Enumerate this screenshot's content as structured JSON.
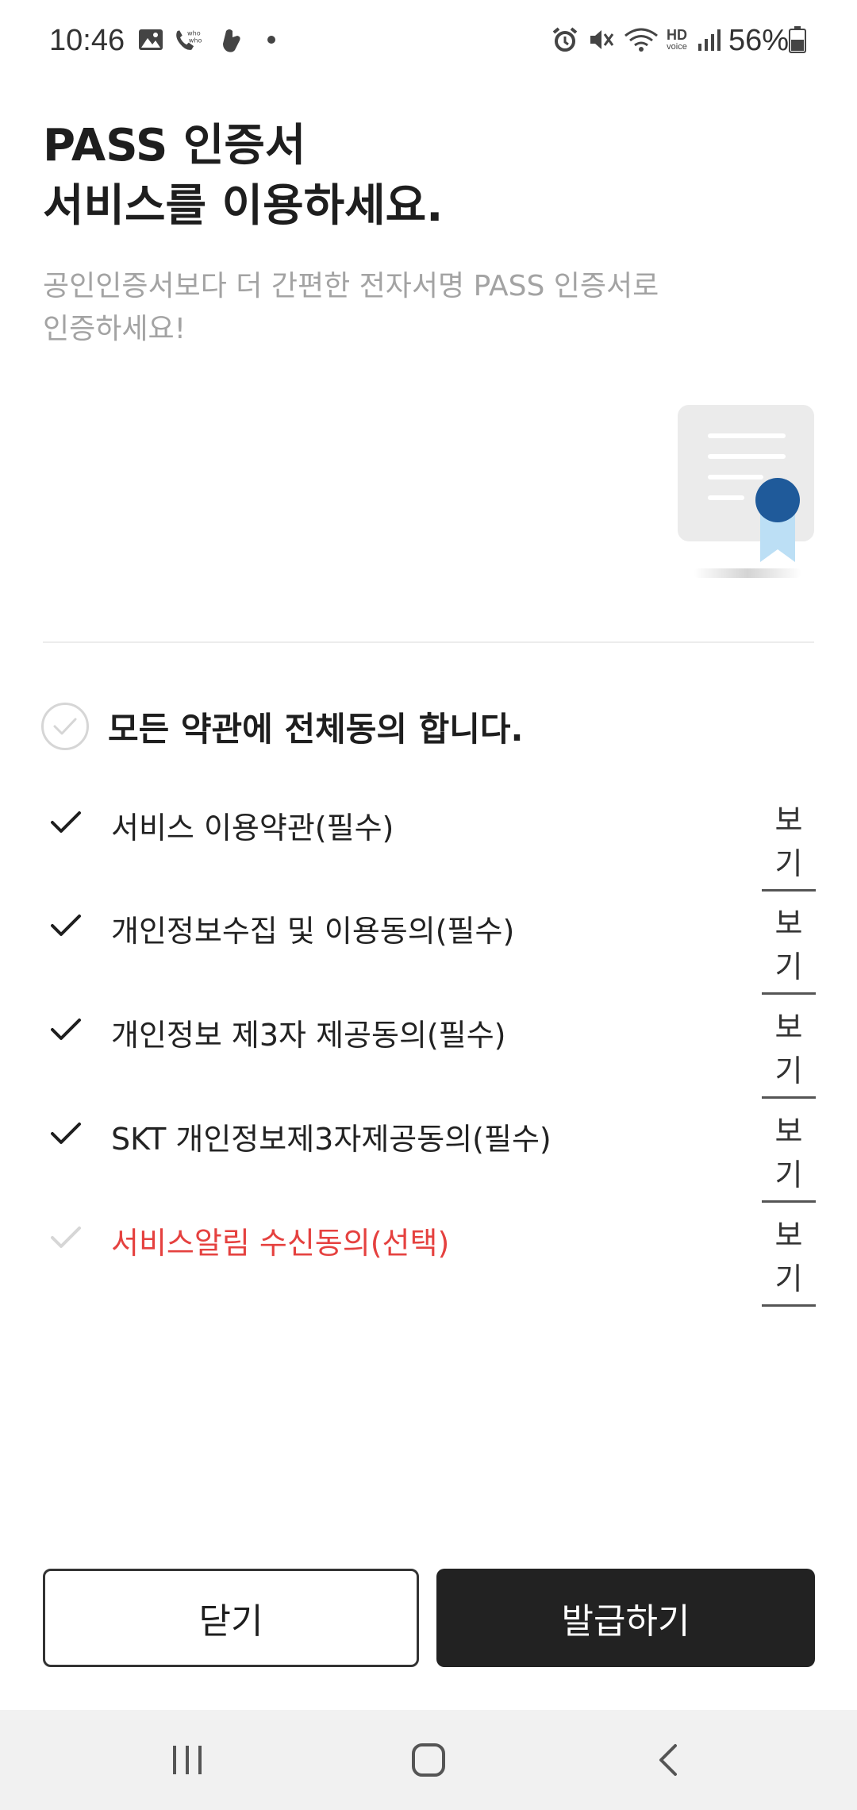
{
  "status_bar": {
    "time": "10:46",
    "battery": "56%",
    "left_icons": [
      "gallery-icon",
      "whowho-call-icon",
      "hand-icon",
      "dot-icon"
    ],
    "right_icons": [
      "alarm-icon",
      "vibrate-mute-icon",
      "wifi-icon",
      "hd-voice-icon",
      "signal-icon",
      "battery-icon"
    ],
    "hd_text": "HD",
    "voice_text": "voice"
  },
  "header": {
    "title_line1": "PASS 인증서",
    "title_line2": "서비스를 이용하세요.",
    "subtitle_line1": "공인인증서보다 더 간편한 전자서명 PASS 인증서로",
    "subtitle_line2": "인증하세요!"
  },
  "agree_all": {
    "label": "모든 약관에 전체동의 합니다.",
    "checked": false
  },
  "terms": [
    {
      "label": "서비스 이용약관(필수)",
      "view": "보기",
      "checked": true,
      "optional": false
    },
    {
      "label": "개인정보수집 및 이용동의(필수)",
      "view": "보기",
      "checked": true,
      "optional": false
    },
    {
      "label": "개인정보 제3자 제공동의(필수)",
      "view": "보기",
      "checked": true,
      "optional": false
    },
    {
      "label": "SKT 개인정보제3자제공동의(필수)",
      "view": "보기",
      "checked": true,
      "optional": false
    },
    {
      "label": "서비스알림 수신동의(선택)",
      "view": "보기",
      "checked": false,
      "optional": true
    }
  ],
  "buttons": {
    "close": "닫기",
    "issue": "발급하기"
  },
  "colors": {
    "primary_dark": "#222222",
    "optional_red": "#e5413f",
    "subtitle_gray": "#a3a3a3",
    "cert_blue": "#1f5a9a",
    "ribbon_light_blue": "#bcdff5"
  }
}
